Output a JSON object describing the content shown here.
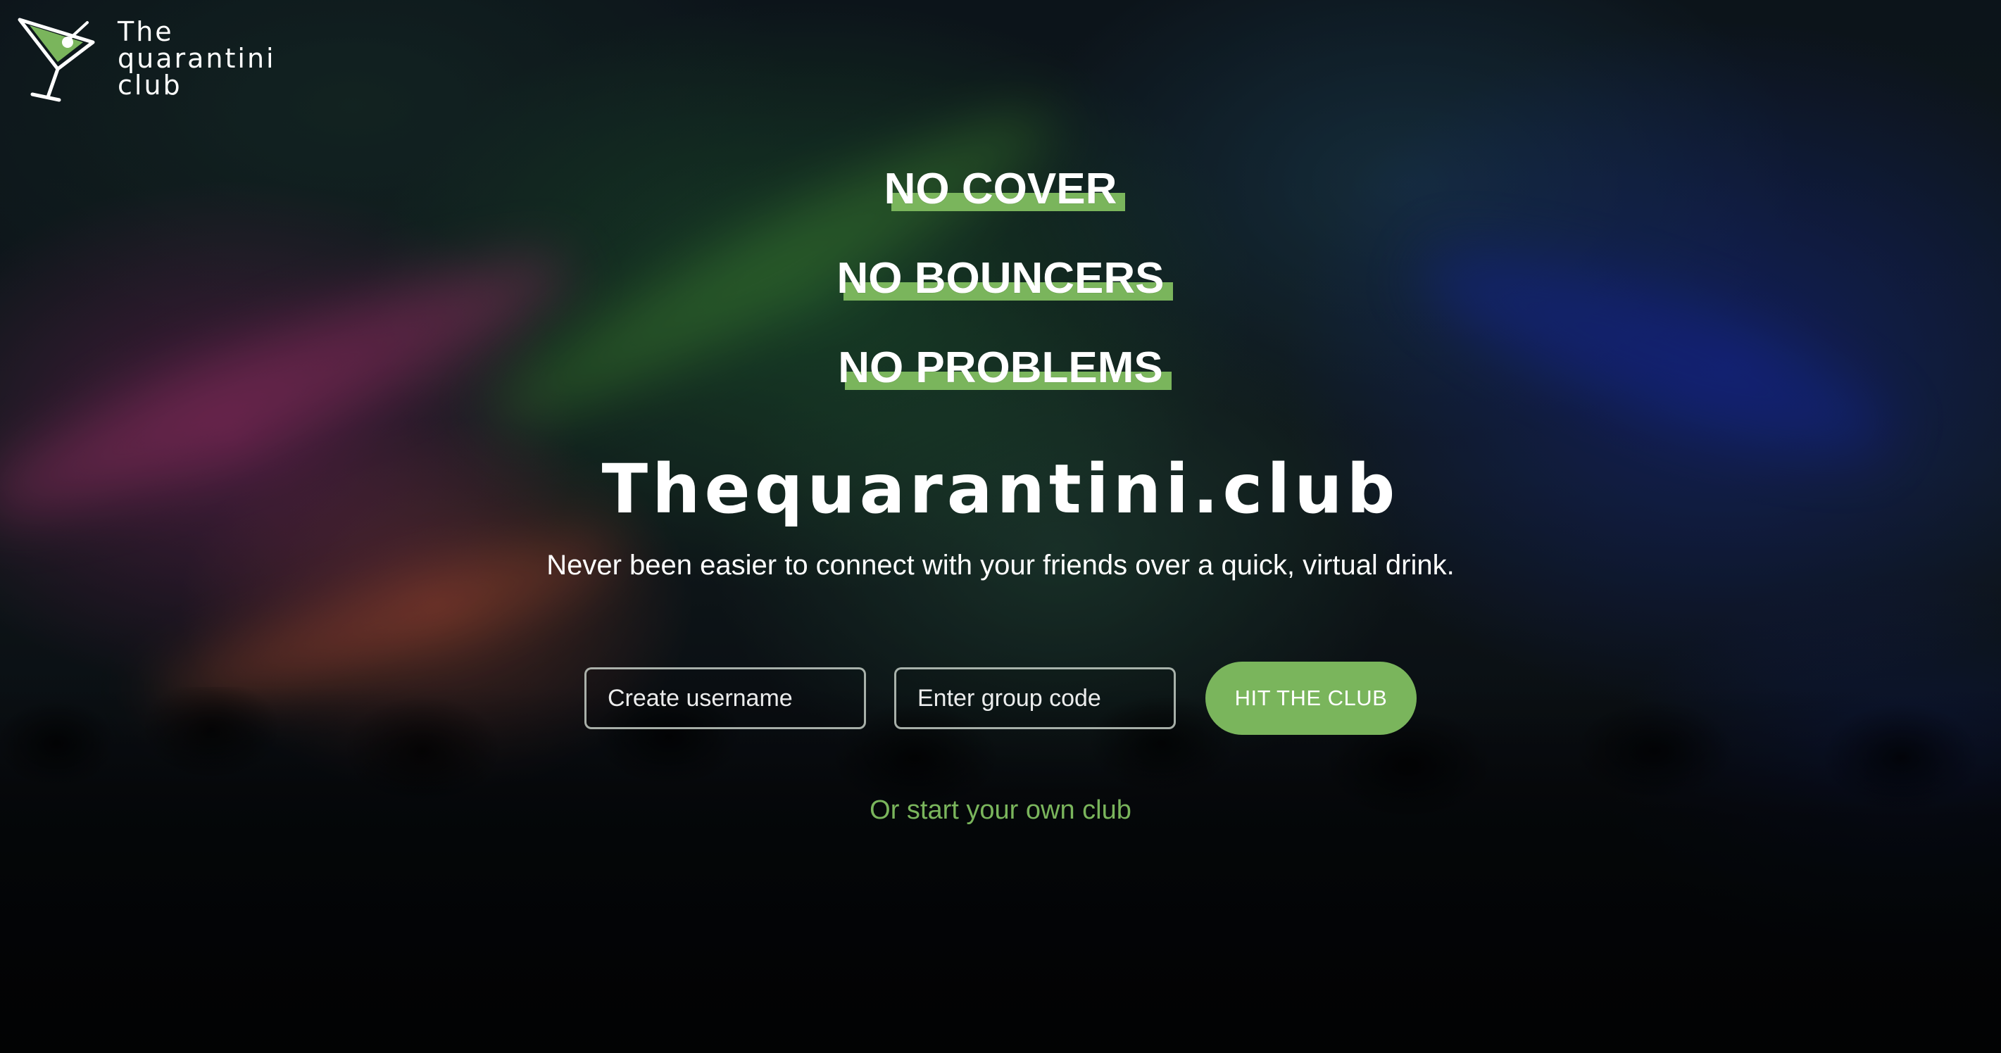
{
  "brand": {
    "logo_lines": [
      "The",
      "quarantini",
      "club"
    ],
    "icon": "martini-glass-icon",
    "accent_color": "#7ab55c"
  },
  "hero": {
    "taglines": [
      "NO COVER",
      "NO BOUNCERS",
      "NO PROBLEMS"
    ],
    "title": "Thequarantini.club",
    "subtitle": "Never been easier to connect with your friends over a quick, virtual drink."
  },
  "form": {
    "username_placeholder": "Create username",
    "group_code_placeholder": "Enter group code",
    "submit_label": "HIT THE CLUB"
  },
  "links": {
    "start_own_club": "Or start your own club"
  }
}
